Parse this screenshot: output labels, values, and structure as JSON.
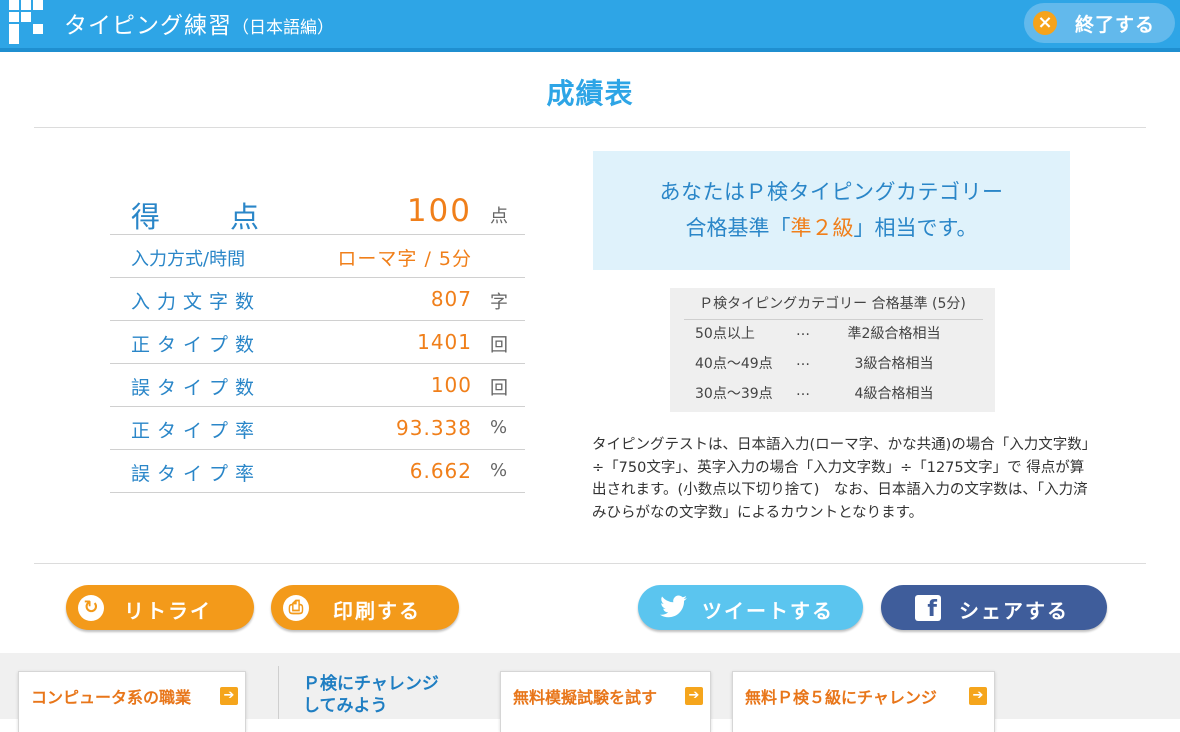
{
  "header": {
    "title": "タイピング練習",
    "subtitle": "（日本語編）",
    "exit_label": "終了する",
    "exit_icon": "close-icon"
  },
  "page_title": "成績表",
  "score": {
    "label_chars": [
      "得",
      "点"
    ],
    "value": "100",
    "unit": "点"
  },
  "method": {
    "label": "入力方式/時間",
    "value": "ローマ字 / 5分"
  },
  "stats": [
    {
      "label": "入力文字数",
      "value": "807",
      "unit": "字"
    },
    {
      "label": "正タイプ数",
      "value": "1401",
      "unit": "回"
    },
    {
      "label": "誤タイプ数",
      "value": "100",
      "unit": "回"
    },
    {
      "label": "正タイプ率",
      "value": "93.338",
      "unit": "%"
    },
    {
      "label": "誤タイプ率",
      "value": "6.662",
      "unit": "%"
    }
  ],
  "pass_message": {
    "line1": "あなたはＰ検タイピングカテゴリー",
    "line2_pre": "合格基準「",
    "grade": "準２級",
    "line2_post": "」相当です。"
  },
  "criteria": {
    "title": "Ｐ検タイピングカテゴリー 合格基準 (5分)",
    "rows": [
      {
        "range": "50点以上",
        "sep": "…",
        "grade": "準2級合格相当"
      },
      {
        "range": "40点～49点",
        "sep": "…",
        "grade": "3級合格相当"
      },
      {
        "range": "30点～39点",
        "sep": "…",
        "grade": "4級合格相当"
      }
    ]
  },
  "note": "タイピングテストは、日本語入力(ローマ字、かな共通)の場合「入力文字数」÷「750文字」、英字入力の場合「入力文字数」÷「1275文字」で 得点が算出されます。(小数点以下切り捨て)　なお、日本語入力の文字数は、「入力済みひらがなの文字数」によるカウントとなります。",
  "actions": {
    "retry": "リトライ",
    "print": "印刷する",
    "tweet": "ツイートする",
    "share": "シェアする"
  },
  "footer": {
    "computer_jobs": "コンピュータ系の職業",
    "challenge_line1": "Ｐ検にチャレンジ",
    "challenge_line2": "してみよう",
    "mock_exam": "無料模擬試験を試す",
    "grade5": "無料Ｐ検５級にチャレンジ",
    "arrow_icon": "arrow-right-icon"
  },
  "colors": {
    "header_blue": "#2ea5e6",
    "accent_orange": "#f07f1a",
    "label_blue": "#2a86c8",
    "twitter": "#5bc5ef",
    "facebook": "#3f5d9b"
  }
}
